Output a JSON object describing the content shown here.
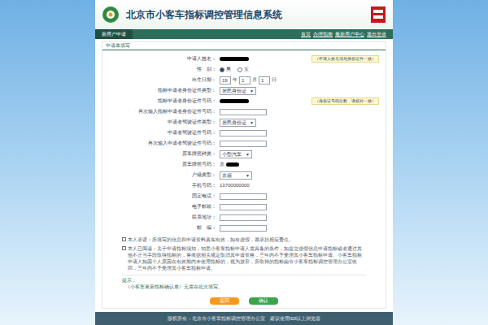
{
  "window": {
    "title": "北京市小客车指标调控管理信息系统"
  },
  "nav": {
    "tab": "新用户申请",
    "links": [
      "首页",
      "办理指南",
      "最新用户中心",
      "退出登录"
    ]
  },
  "section": {
    "title": "申请单填写"
  },
  "form": [
    {
      "label": "申请人姓名：",
      "kind": "redacted",
      "note": "（申请人姓名须与身份证件一致）"
    },
    {
      "label": "性　别：",
      "kind": "radio",
      "options": [
        {
          "label": "男",
          "selected": true
        },
        {
          "label": "女",
          "selected": false
        }
      ]
    },
    {
      "label": "出生日期：",
      "kind": "date",
      "parts": [
        "19",
        "年",
        "1",
        "月",
        "1",
        "日"
      ]
    },
    {
      "label": "指标申请者身份证件类型：",
      "kind": "select",
      "value": "居民身份证"
    },
    {
      "label": "指标申请者身份证件号码：",
      "kind": "redacted",
      "note": "（身份证号码位数，请核对一致）"
    },
    {
      "label": "再次输入指标申请者身份证件号码：",
      "kind": "input",
      "value": ""
    },
    {
      "label": "申请者驾驶证件类型：",
      "kind": "select",
      "value": "居民身份证"
    },
    {
      "label": "申请者驾驶证件号码：",
      "kind": "input",
      "value": ""
    },
    {
      "label": "再次输入申请者驾驶证件号码：",
      "kind": "input",
      "value": ""
    },
    {
      "label": "原车牌照种类：",
      "kind": "select",
      "value": "小型汽车"
    },
    {
      "label": "原车牌照号码：",
      "kind": "plate",
      "value": "京"
    },
    {
      "label": "户籍类型：",
      "kind": "select",
      "value": "京籍"
    },
    {
      "label": "手机号码：",
      "kind": "text",
      "value": "13700000000"
    },
    {
      "label": "固定电话：",
      "kind": "input",
      "value": ""
    },
    {
      "label": "电子邮箱：",
      "kind": "input",
      "value": ""
    },
    {
      "label": "联系地址：",
      "kind": "input",
      "value": ""
    },
    {
      "label": "邮　编：",
      "kind": "input",
      "value": ""
    }
  ],
  "agreements": [
    {
      "checked": false,
      "text": "本人承诺：所填写的信息和申请资料真实有效，如有虚假，愿承担相应责任。"
    },
    {
      "checked": false,
      "text": "本人已阅读：关于申请指标须知，知悉小客车指标申请人需具备的条件，如提交虚假信息申请指标或者通过其他不正当手段取得指标的，将依据相关规定取消其申请资格，三年内不予受理其小客车指标申请。小客车指标申请人如因个人原因在有效期内未使用指标的，视为放弃，所取得的指标由市小客车指标调控管理办公室收回，三年内不予受理其小客车指标申请。"
    }
  ],
  "tip": {
    "title": "提示：",
    "text": "《小客车更新指标确认单》无需在此次填写。"
  },
  "buttons": [
    {
      "label": "返回",
      "color": "#f39a1e"
    },
    {
      "label": "确认",
      "color": "#3aa64a"
    }
  ],
  "footer": "版权所有：北京市小客车指标调控管理办公室　建议使用IE8以上浏览器"
}
